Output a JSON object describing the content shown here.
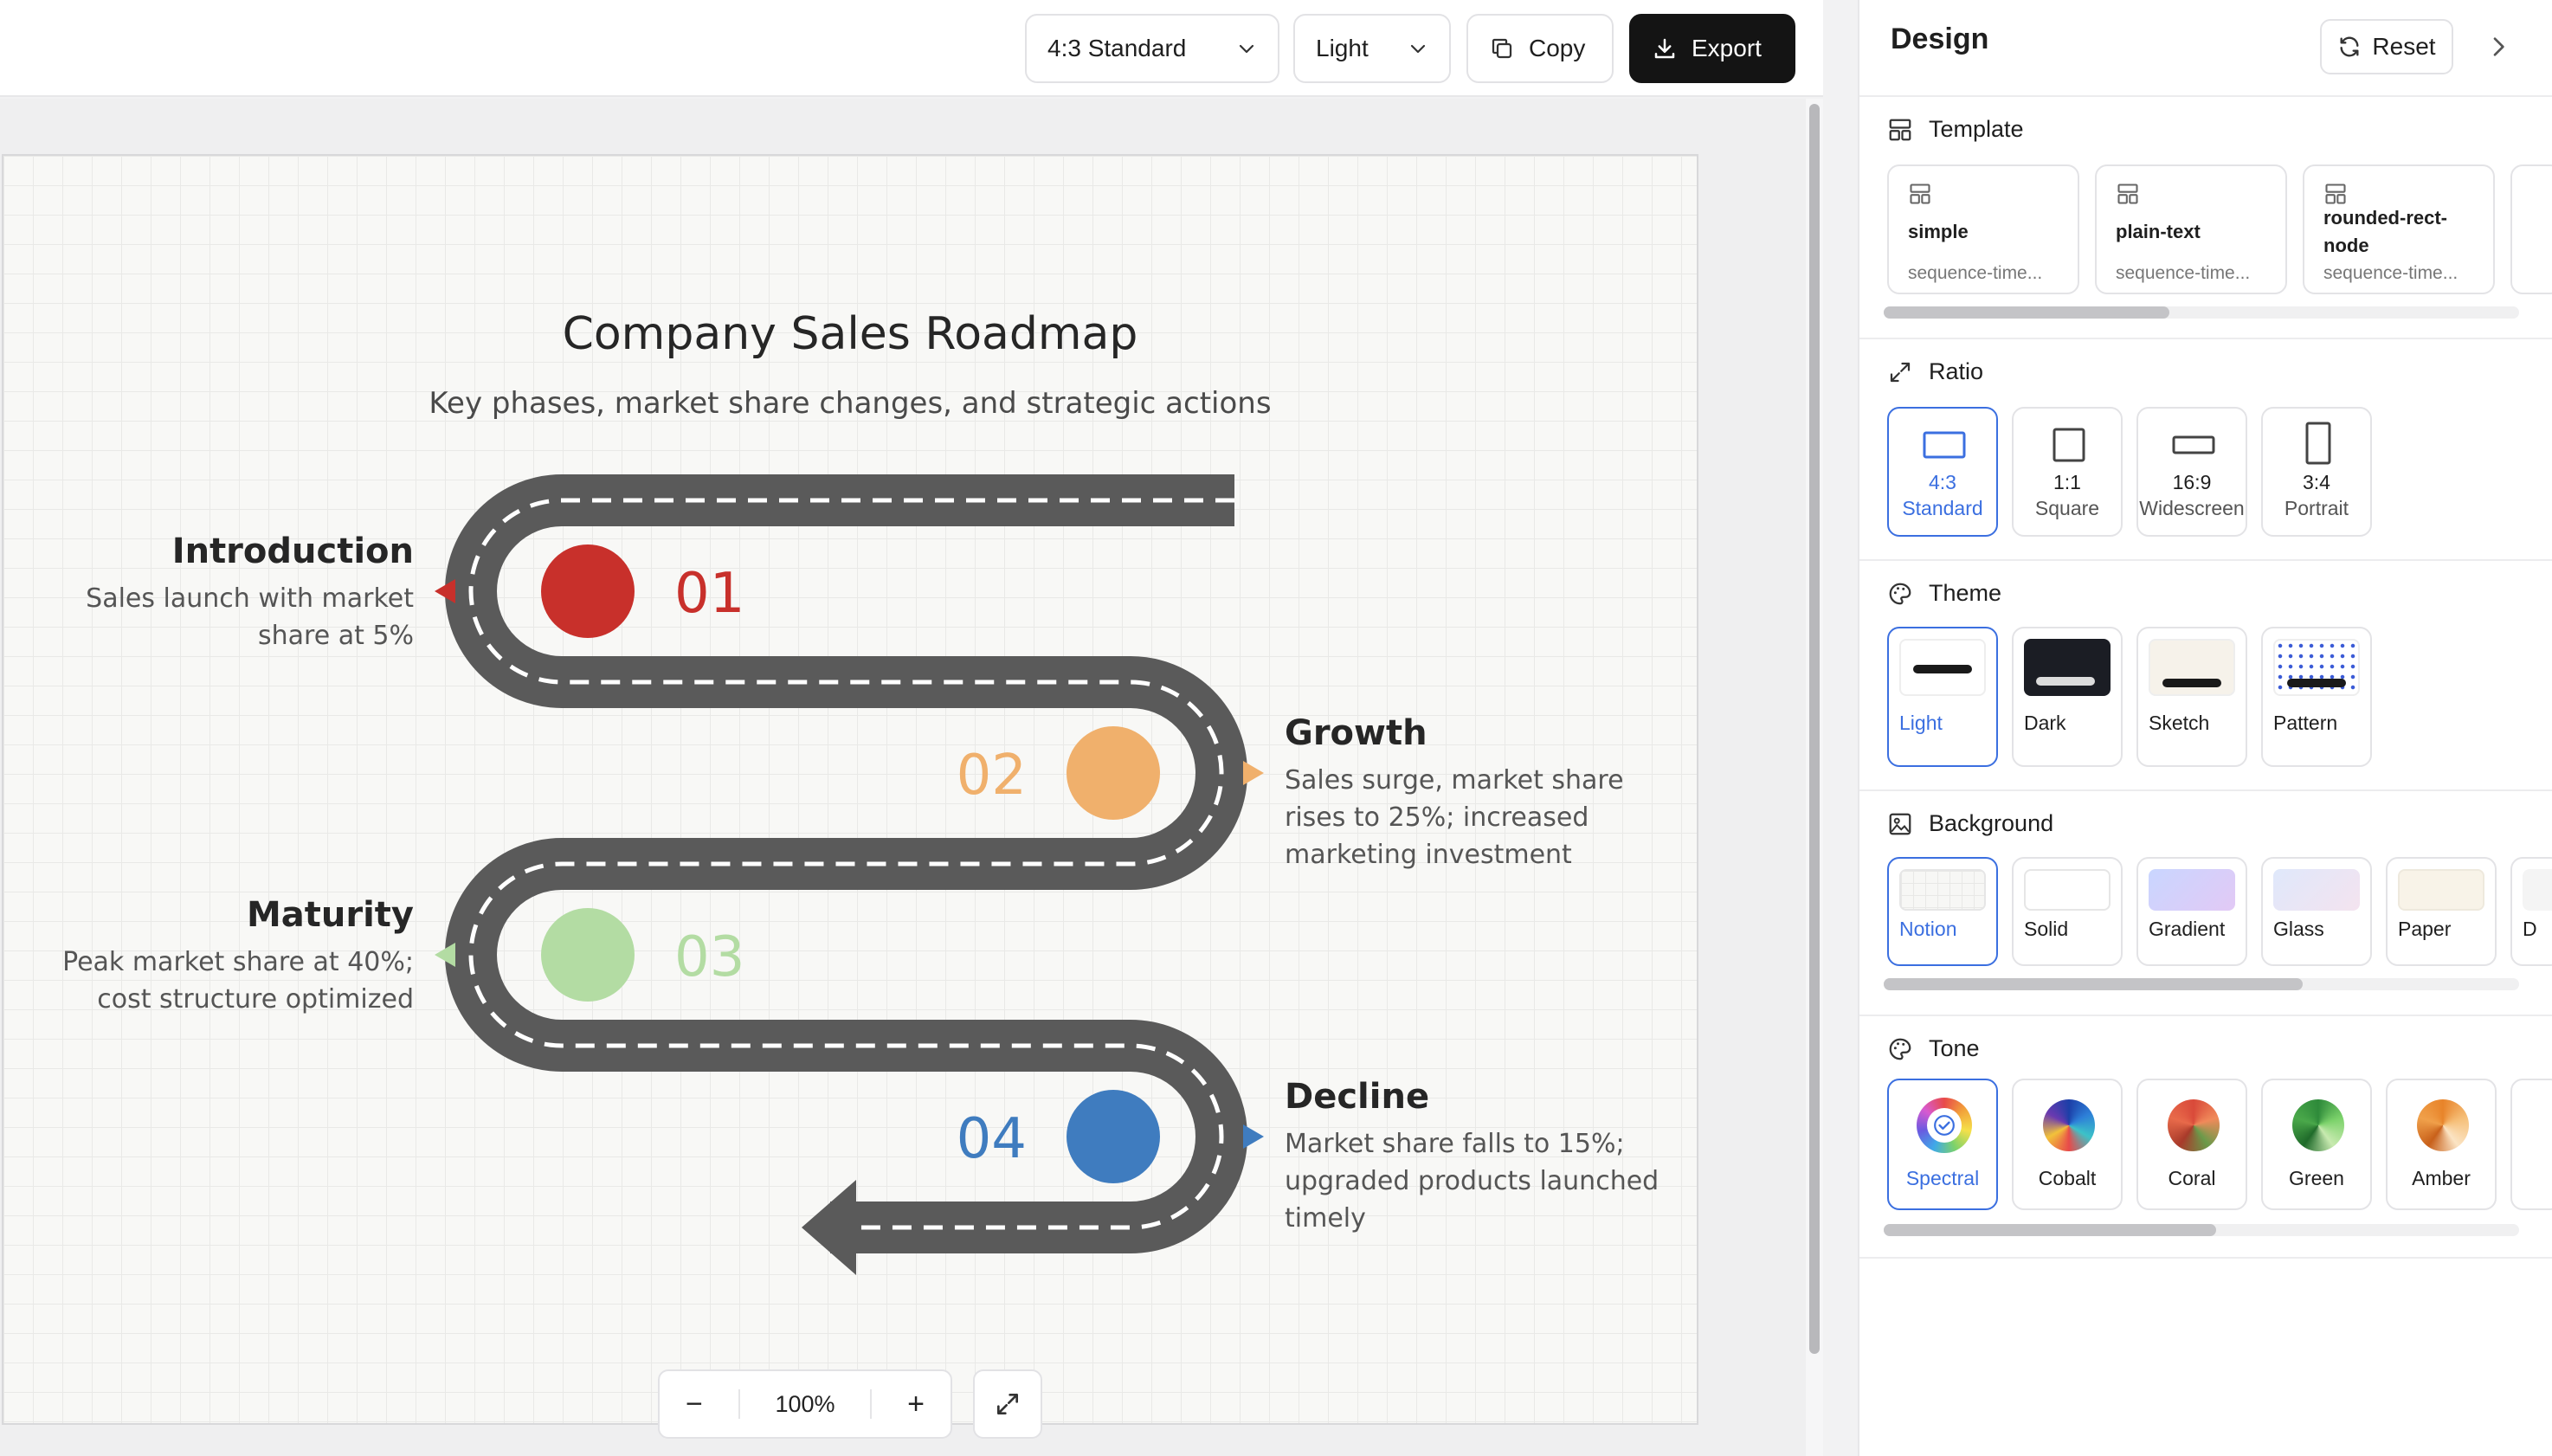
{
  "toolbar": {
    "ratio_select": "4:3 Standard",
    "theme_select": "Light",
    "copy_label": "Copy",
    "export_label": "Export"
  },
  "infographic": {
    "title": "Company Sales Roadmap",
    "subtitle": "Key phases, market share changes, and strategic actions",
    "phases": [
      {
        "number": "01",
        "title": "Introduction",
        "desc_lines": [
          "Sales launch with market",
          "share at 5%"
        ],
        "color": "#c8302b"
      },
      {
        "number": "02",
        "title": "Growth",
        "desc_lines": [
          "Sales surge, market share",
          "rises to 25%; increased",
          "marketing investment"
        ],
        "color": "#f0b06c"
      },
      {
        "number": "03",
        "title": "Maturity",
        "desc_lines": [
          "Peak market share at 40%;",
          "cost structure optimized"
        ],
        "color": "#b3dca3"
      },
      {
        "number": "04",
        "title": "Decline",
        "desc_lines": [
          "Market share falls to 15%;",
          "upgraded products launched",
          "timely"
        ],
        "color": "#3f7cbf"
      }
    ],
    "road_color": "#5a5a5a"
  },
  "zoom": {
    "level": "100%",
    "minus": "−",
    "plus": "+"
  },
  "panel": {
    "title": "Design",
    "reset_label": "Reset",
    "template": {
      "label": "Template",
      "items": [
        {
          "name": "simple",
          "sub": "sequence-time..."
        },
        {
          "name": "plain-text",
          "sub": "sequence-time..."
        },
        {
          "name": "rounded-rect-node",
          "name_lines": [
            "rounded-rect-",
            "node"
          ],
          "sub": "sequence-time..."
        }
      ]
    },
    "ratio": {
      "label": "Ratio",
      "items": [
        {
          "value": "4:3",
          "name": "Standard",
          "selected": true
        },
        {
          "value": "1:1",
          "name": "Square"
        },
        {
          "value": "16:9",
          "name": "Widescreen"
        },
        {
          "value": "3:4",
          "name": "Portrait"
        }
      ]
    },
    "theme": {
      "label": "Theme",
      "items": [
        {
          "name": "Light",
          "selected": true
        },
        {
          "name": "Dark"
        },
        {
          "name": "Sketch"
        },
        {
          "name": "Pattern"
        }
      ]
    },
    "background": {
      "label": "Background",
      "items": [
        {
          "name": "Notion",
          "selected": true
        },
        {
          "name": "Solid"
        },
        {
          "name": "Gradient"
        },
        {
          "name": "Glass"
        },
        {
          "name": "Paper"
        },
        {
          "name": "D"
        }
      ]
    },
    "tone": {
      "label": "Tone",
      "items": [
        {
          "name": "Spectral",
          "selected": true
        },
        {
          "name": "Cobalt"
        },
        {
          "name": "Coral"
        },
        {
          "name": "Green"
        },
        {
          "name": "Amber"
        }
      ]
    }
  },
  "colors": {
    "accent": "#3b6fe0",
    "export_bg": "#141414"
  }
}
